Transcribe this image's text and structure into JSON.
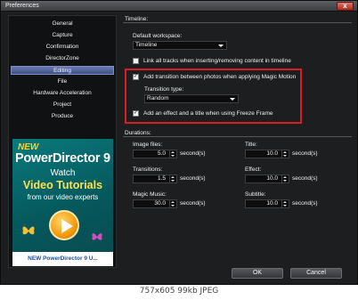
{
  "window": {
    "title": "Preferences",
    "close_glyph": "x"
  },
  "sidebar": {
    "items": [
      {
        "label": "General"
      },
      {
        "label": "Capture"
      },
      {
        "label": "Confirmation"
      },
      {
        "label": "DirectorZone"
      },
      {
        "label": "Editing",
        "selected": true
      },
      {
        "label": "File"
      },
      {
        "label": "Hardware Acceleration"
      },
      {
        "label": "Project"
      },
      {
        "label": "Produce"
      }
    ],
    "promo": {
      "new": "NEW",
      "product": "PowerDirector 9",
      "watch": "Watch",
      "video_tutorials": "Video Tutorials",
      "from": "from our video experts",
      "bottom": "NEW PowerDirector 9 U..."
    }
  },
  "timeline": {
    "group_label": "Timeline:",
    "workspace_label": "Default workspace:",
    "workspace_value": "Timeline",
    "link_tracks_label": "Link all tracks when inserting/removing content in timeline",
    "link_tracks_checked": false,
    "add_transition_label": "Add transition between photos when applying Magic Motion",
    "add_transition_checked": true,
    "transition_type_label": "Transition type:",
    "transition_type_value": "Random",
    "add_effect_label": "Add an effect and a title when using Freeze Frame",
    "add_effect_checked": true
  },
  "durations": {
    "group_label": "Durations:",
    "image_files": {
      "label": "Image files:",
      "value": "5.0",
      "unit": "second(s)"
    },
    "title": {
      "label": "Title:",
      "value": "10.0",
      "unit": "second(s)"
    },
    "transitions": {
      "label": "Transitions:",
      "value": "1.5",
      "unit": "second(s)"
    },
    "effect": {
      "label": "Effect:",
      "value": "10.0",
      "unit": "second(s)"
    },
    "magic_music": {
      "label": "Magic Music:",
      "value": "30.0",
      "unit": "second(s)"
    },
    "subtitle": {
      "label": "Subtitle:",
      "value": "10.0",
      "unit": "second(s)"
    }
  },
  "buttons": {
    "ok": "OK",
    "cancel": "Cancel"
  },
  "caption": "757x605  99kb  JPEG",
  "colors": {
    "accent": "#4a5b94",
    "highlight_border": "#d81f26",
    "background": "#1d1e20"
  },
  "icons": [
    "close-icon",
    "play-icon",
    "butterfly-icon",
    "dropdown-arrow-icon",
    "checkmark-icon",
    "spin-up-icon",
    "spin-down-icon"
  ]
}
